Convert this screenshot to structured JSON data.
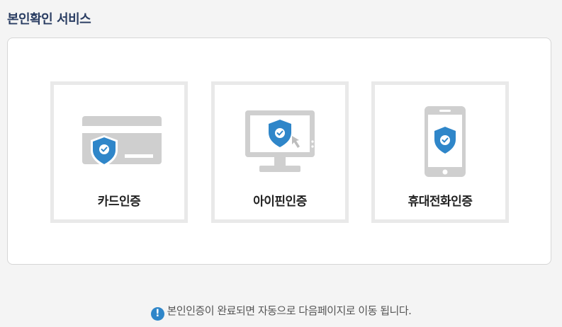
{
  "header": {
    "title": "본인확인 서비스"
  },
  "options": [
    {
      "label": "카드인증",
      "icon": "credit-card-shield-icon"
    },
    {
      "label": "아이핀인증",
      "icon": "monitor-shield-cursor-icon"
    },
    {
      "label": "휴대전화인증",
      "icon": "mobile-phone-shield-icon"
    }
  ],
  "footer": {
    "notice_icon": "exclamation-circle-icon",
    "notice_text": "본인인증이 완료되면 자동으로 다음페이지로 이동 됩니다."
  },
  "colors": {
    "title": "#2b3e63",
    "shield": "#2f86c9",
    "icon_gray": "#cfcfcf",
    "card_border": "#e9e9e9"
  }
}
